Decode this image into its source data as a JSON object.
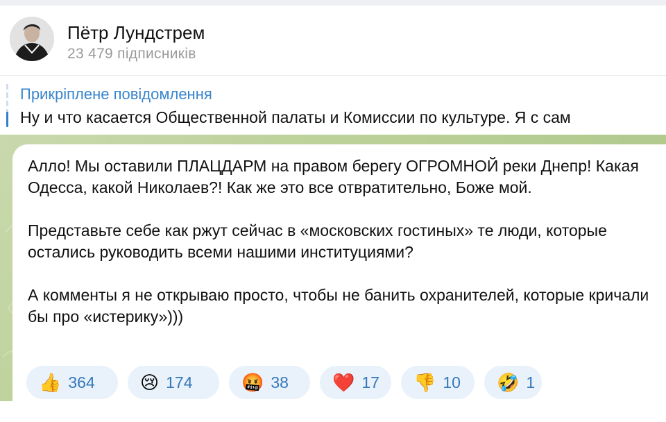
{
  "channel": {
    "name": "Пётр Лундстрем",
    "subscribers": "23 479 підписників"
  },
  "pinned": {
    "title": "Прикріплене повідомлення",
    "text": "Ну и что касается Общественной палаты и Комиссии по культуре. Я с сам"
  },
  "message": {
    "paragraphs": [
      "Алло! Мы оставили ПЛАЦДАРМ на правом берегу ОГРОМНОЙ реки Днепр! Какая Одесса, какой Николаев?! Как же это все отвратительно, Боже мой.",
      "Представьте себе как ржут сейчас в «московских гостиных» те люди, которые остались руководить всеми нашими институциями?",
      "А комменты я не открываю просто, чтобы не банить охранителей, которые кричали бы про «истерику»)))"
    ]
  },
  "reactions": [
    {
      "emoji": "👍",
      "icon": "thumbs-up-icon",
      "count": "364"
    },
    {
      "emoji": "😢",
      "icon": "crying-face-icon",
      "count": "174"
    },
    {
      "emoji": "🤬",
      "icon": "swearing-face-icon",
      "count": "38"
    },
    {
      "emoji": "❤️",
      "icon": "red-heart-icon",
      "count": "17"
    },
    {
      "emoji": "👎",
      "icon": "thumbs-down-icon",
      "count": "10"
    },
    {
      "emoji": "🤣",
      "icon": "rofl-face-icon",
      "count": "1"
    }
  ],
  "colors": {
    "accent": "#3a85cc",
    "reaction_bg": "#e9f1fa",
    "reaction_count": "#3478b9",
    "chat_background": "#b9cf95"
  }
}
